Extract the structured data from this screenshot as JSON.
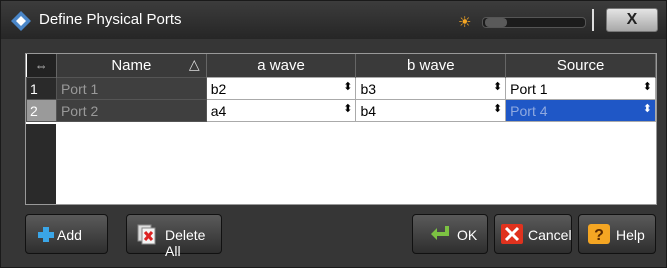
{
  "window": {
    "title": "Define Physical Ports",
    "close_label": "X"
  },
  "table": {
    "columns": [
      "Name",
      "a wave",
      "b wave",
      "Source"
    ],
    "rows": [
      {
        "num": "1",
        "name": "Port 1",
        "a": "b2",
        "b": "b3",
        "source": "Port 1"
      },
      {
        "num": "2",
        "name": "Port 2",
        "a": "a4",
        "b": "b4",
        "source": "Port 4"
      }
    ]
  },
  "buttons": {
    "add": "Add",
    "delete_all": "Delete All",
    "ok": "OK",
    "cancel": "Cancel",
    "help": "Help"
  },
  "icons": {
    "logo": "rs-logo-icon",
    "brightness": "sun-icon",
    "add": "plus-icon",
    "delete": "delete-all-icon",
    "ok": "ok-arrow-icon",
    "cancel": "cancel-x-icon",
    "help": "help-icon"
  },
  "colors": {
    "selection": "#1f57c6",
    "accent": "#f5a623"
  }
}
